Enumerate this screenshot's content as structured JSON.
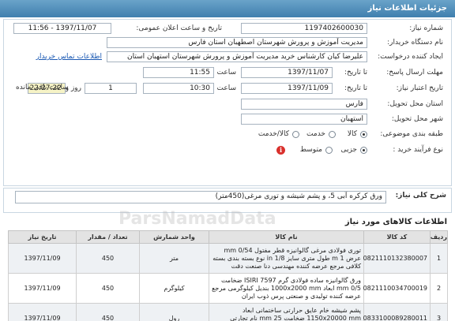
{
  "page": {
    "title": "جزئیات اطلاعات نیاز"
  },
  "form": {
    "need_number": {
      "label": "شماره نیاز:",
      "value": "1197402600030"
    },
    "announce_datetime": {
      "label": "تاریخ و ساعت اعلان عمومی:",
      "value": "1397/11/07 - 11:56"
    },
    "buyer_org": {
      "label": "نام دستگاه خریدار:",
      "value": "مدیریت آموزش و پرورش شهرستان اصطهبان استان فارس"
    },
    "requester": {
      "label": "ایجاد کننده درخواست:",
      "value": "علیرضا کیان کارشناس خرید مدیریت آموزش و پرورش شهرستان استهبان استان",
      "contact_link": "اطلاعات تماس خریدار"
    },
    "reply_deadline": {
      "label": "مهلت ارسال پاسخ:",
      "from_label": "تا تاریخ:",
      "date": "1397/11/07",
      "time_label": "ساعت",
      "time": "11:55"
    },
    "validity": {
      "label": "تاریخ اعتبار نیاز:",
      "from_label": "تا تاریخ:",
      "date": "1397/11/09",
      "time_label": "ساعت",
      "time": "10:30",
      "days": "1",
      "day_label": "روز و",
      "countdown": "22:27:22",
      "remaining_label": "ساعت باقی مانده"
    },
    "province": {
      "label": "استان محل تحویل:",
      "value": "فارس"
    },
    "city": {
      "label": "شهر محل تحویل:",
      "value": "استهبان"
    },
    "category": {
      "label": "طبقه بندی موضوعی:",
      "options": [
        "کالا",
        "خدمت",
        "کالا/خدمت"
      ]
    },
    "process": {
      "label": "نوع فرآیند خرید :",
      "options": [
        "جزیی",
        "متوسط"
      ]
    }
  },
  "description": {
    "label": "شرح کلی نیاز:",
    "value": "ورق کرکره آبی 5، و پشم شیشه و توری مرغی(450متر)"
  },
  "goods": {
    "title": "اطلاعات کالاهای مورد نیاز",
    "columns": [
      "ردیف",
      "کد کالا",
      "نام کالا",
      "واحد شمارش",
      "تعداد / مقدار",
      "تاریخ نیاز"
    ],
    "rows": [
      {
        "row": "1",
        "code": "0821110132380007",
        "name": "توری فولادی مرغی گالوانیزه قطر مفتول 0/54 mm عرض 1 m طول متری سایز in 1/8 نوع بسته بندی بسته کلافی مرجع عرضه کننده مهندسی دنا صنعت دقت",
        "unit": "متر",
        "qty": "450",
        "date": "1397/11/09"
      },
      {
        "row": "2",
        "code": "0821110034700019",
        "name": "ورق گالوانیزه ساده فولادی گرم ISIRI 7597 ضخامت 0/5 mm ابعاد 1000x2000 mm بندیل کیلوگرمی مرجع عرضه کننده تولیدی و صنعتی پرس ذوب ایران",
        "unit": "کیلوگرم",
        "qty": "450",
        "date": "1397/11/09"
      },
      {
        "row": "3",
        "code": "0833100089280011",
        "name": "پشم شیشه خام عایق حرارتی ساختمانی ابعاد 1150x20000 mm ضخامت 25 mm نام تجارتی ایزوجام",
        "unit": "رول",
        "qty": "450",
        "date": "1397/11/09"
      }
    ]
  },
  "watermark": "ParsNamadData"
}
